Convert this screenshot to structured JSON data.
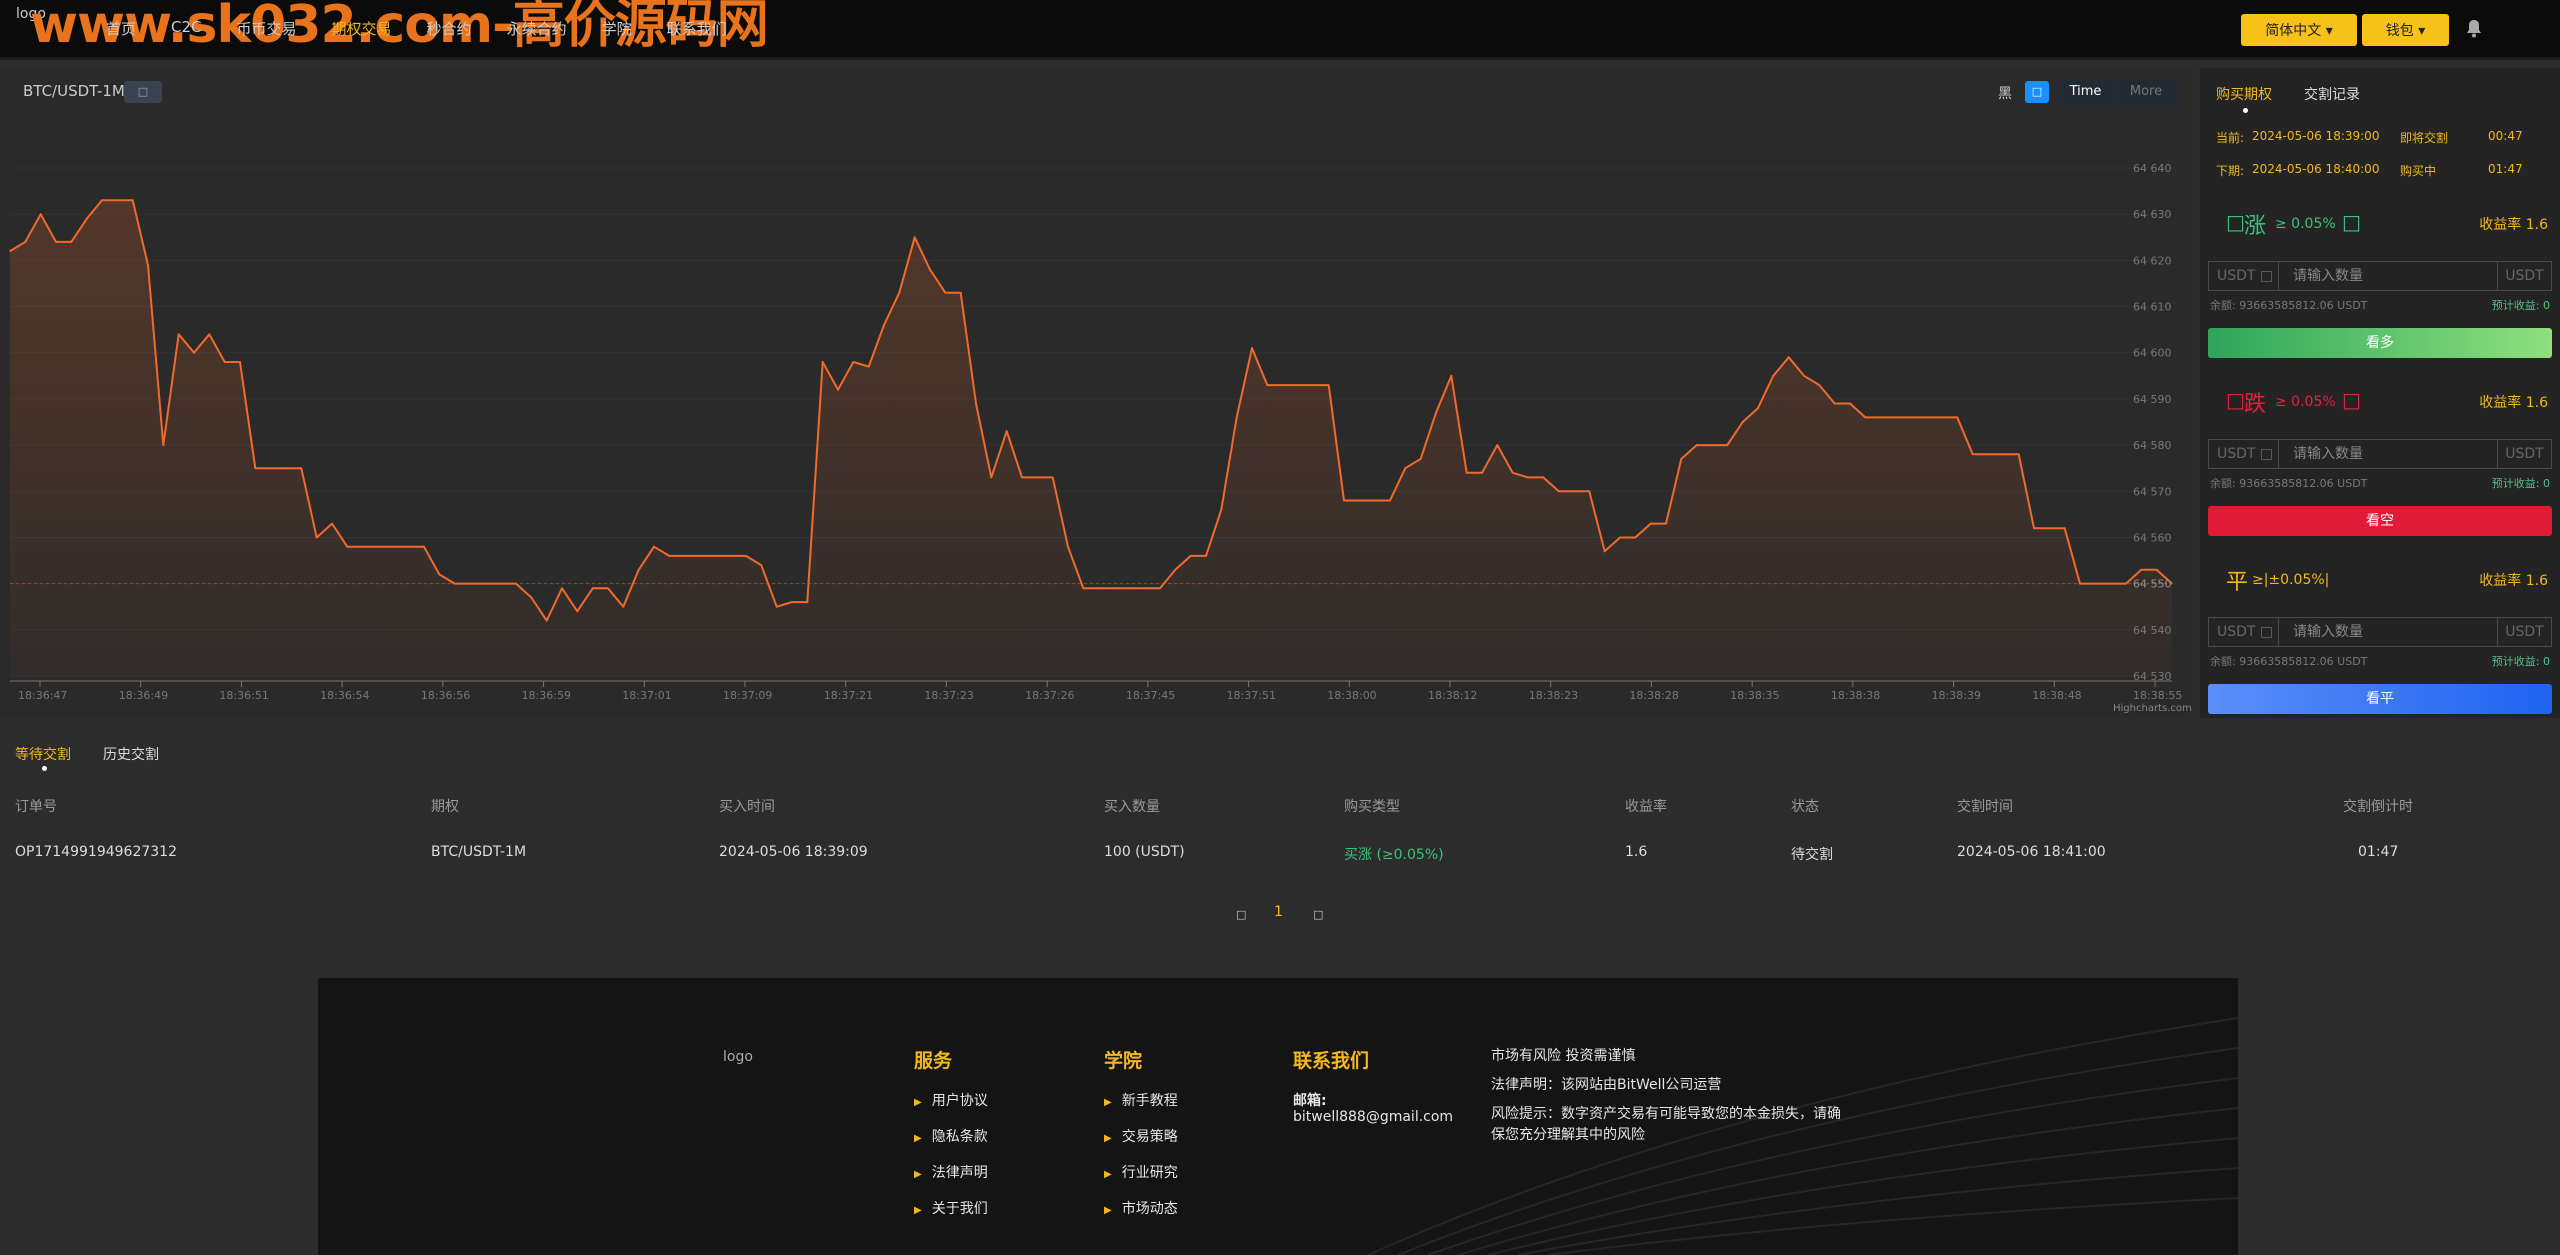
{
  "header": {
    "logo_alt": "logo",
    "watermark": "www.sk032.com-高价源码网",
    "nav": [
      "首页",
      "C2C",
      "币币交易",
      "期权交易",
      "秒合约",
      "永续合约",
      "学院",
      "联系我们"
    ],
    "nav_active": 3,
    "lang_btn": "简体中文 ▾",
    "wallet_btn": "钱包 ▾"
  },
  "chart_panel": {
    "pair": "BTC/USDT-1M",
    "pair_icon": "□",
    "theme_label": "黑",
    "toggle_icon": "□",
    "btn_time": "Time",
    "btn_more": "More",
    "credits": "Highcharts.com"
  },
  "chart_data": {
    "type": "area",
    "title": "",
    "xlabel": "",
    "ylabel": "",
    "ylim": [
      64530,
      64640
    ],
    "yticks": [
      "64 530",
      "64 540",
      "64 550",
      "64 560",
      "64 570",
      "64 580",
      "64 590",
      "64 600",
      "64 610",
      "64 620",
      "64 630",
      "64 640"
    ],
    "xticks": [
      "18:36:47",
      "18:36:49",
      "18:36:51",
      "18:36:54",
      "18:36:56",
      "18:36:59",
      "18:37:01",
      "18:37:09",
      "18:37:21",
      "18:37:23",
      "18:37:26",
      "18:37:45",
      "18:37:51",
      "18:38:00",
      "18:38:12",
      "18:38:23",
      "18:38:28",
      "18:38:35",
      "18:38:38",
      "18:38:39",
      "18:38:48",
      "18:38:55"
    ],
    "last_value": "64 550",
    "values": [
      64622,
      64624,
      64630,
      64624,
      64624,
      64629,
      64633,
      64633,
      64633,
      64619,
      64580,
      64604,
      64600,
      64604,
      64598,
      64598,
      64575,
      64575,
      64575,
      64575,
      64560,
      64563,
      64558,
      64558,
      64558,
      64558,
      64558,
      64558,
      64552,
      64550,
      64550,
      64550,
      64550,
      64550,
      64547,
      64542,
      64549,
      64544,
      64549,
      64549,
      64545,
      64553,
      64558,
      64556,
      64556,
      64556,
      64556,
      64556,
      64556,
      64554,
      64545,
      64546,
      64546,
      64598,
      64592,
      64598,
      64597,
      64606,
      64613,
      64625,
      64618,
      64613,
      64613,
      64589,
      64573,
      64583,
      64573,
      64573,
      64573,
      64558,
      64549,
      64549,
      64549,
      64549,
      64549,
      64549,
      64553,
      64556,
      64556,
      64566,
      64586,
      64601,
      64593,
      64593,
      64593,
      64593,
      64593,
      64568,
      64568,
      64568,
      64568,
      64575,
      64577,
      64587,
      64595,
      64574,
      64574,
      64580,
      64574,
      64573,
      64573,
      64570,
      64570,
      64570,
      64557,
      64560,
      64560,
      64563,
      64563,
      64577,
      64580,
      64580,
      64580,
      64585,
      64588,
      64595,
      64599,
      64595,
      64593,
      64589,
      64589,
      64586,
      64586,
      64586,
      64586,
      64586,
      64586,
      64586,
      64578,
      64578,
      64578,
      64578,
      64562,
      64562,
      64562,
      64550,
      64550,
      64550,
      64550,
      64553,
      64553,
      64550
    ]
  },
  "right_panel": {
    "tabs": [
      "购买期权",
      "交割记录"
    ],
    "now_label": "当前:",
    "now_time": "2024-05-06 18:39:00",
    "now_status": "即将交割",
    "now_countdown": "00:47",
    "next_label": "下期:",
    "next_time": "2024-05-06 18:40:00",
    "next_status": "购买中",
    "next_countdown": "01:47",
    "rate_label": "收益率",
    "rate_value": "1.6",
    "input_placeholder": "请输入数量",
    "unit_left": "USDT □",
    "unit_right": "USDT",
    "balance": "余额: 93663585812.06 USDT",
    "expected": "预计收益: 0",
    "options": [
      {
        "icon": "□",
        "name": "涨",
        "cond": "≥ 0.05%",
        "icon2": "□",
        "btn": "看多",
        "color": "#3cc27a"
      },
      {
        "icon": "□",
        "name": "跌",
        "cond": "≥ 0.05%",
        "icon2": "□",
        "btn": "看空",
        "color": "#e5213c"
      },
      {
        "icon": "",
        "name": "平",
        "cond": "≥|±0.05%|",
        "icon2": "",
        "btn": "看平",
        "color": "#f3b81f"
      }
    ]
  },
  "orders": {
    "tabs": [
      "等待交割",
      "历史交割"
    ],
    "headers": [
      "订单号",
      "期权",
      "买入时间",
      "买入数量",
      "购买类型",
      "收益率",
      "状态",
      "交割时间",
      "交割倒计时"
    ],
    "row": [
      "OP1714991949627312",
      "BTC/USDT-1M",
      "2024-05-06 18:39:09",
      "100 (USDT)",
      "买涨 (≥0.05%)",
      "1.6",
      "待交割",
      "2024-05-06 18:41:00",
      "01:47"
    ],
    "pager_prev": "□",
    "pager_page": "1",
    "pager_next": "□"
  },
  "footer": {
    "logo_alt": "logo",
    "col1_title": "服务",
    "col1": [
      "用户协议",
      "隐私条款",
      "法律声明",
      "关于我们"
    ],
    "col2_title": "学院",
    "col2": [
      "新手教程",
      "交易策略",
      "行业研究",
      "市场动态"
    ],
    "col3_title": "联系我们",
    "email_label": "邮箱:",
    "email": "bitwell888@gmail.com",
    "notice1": "市场有风险 投资需谨慎",
    "notice2": "法律声明：该网站由BitWell公司运营",
    "notice3": "风险提示：数字资产交易有可能导致您的本金损失，请确保您充分理解其中的风险"
  }
}
